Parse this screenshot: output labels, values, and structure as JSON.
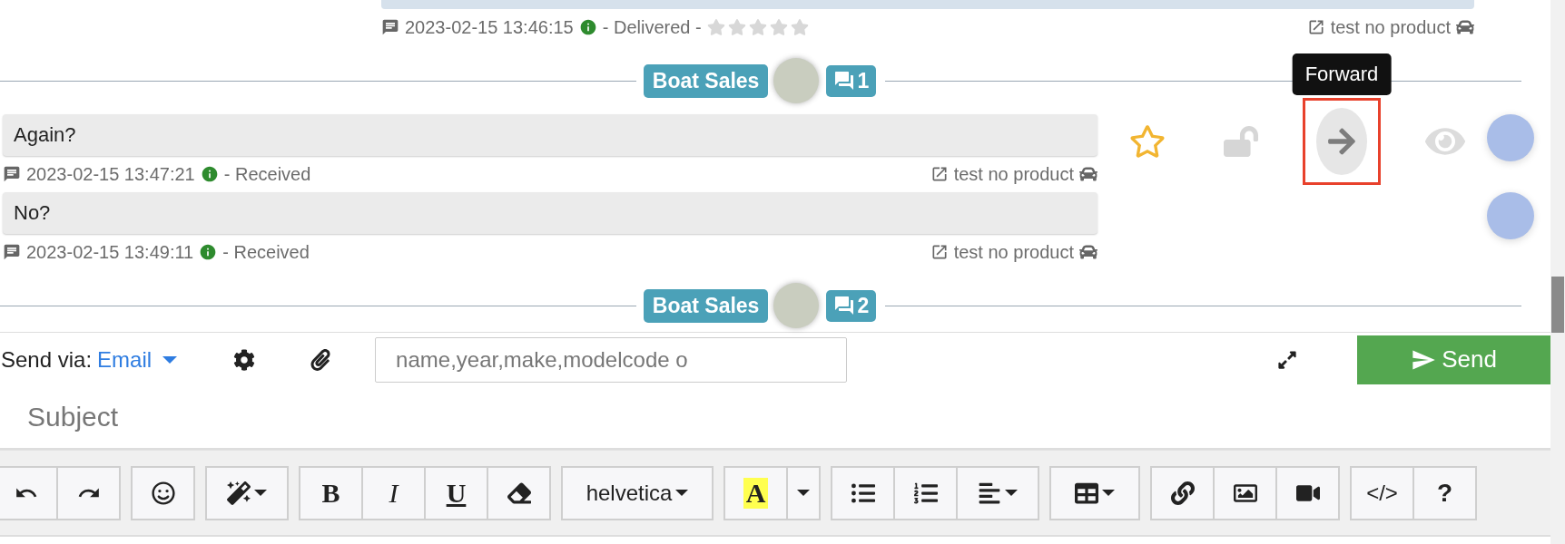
{
  "top_message": {
    "time": "2023-02-15 13:46:15",
    "status": "- Delivered -",
    "stars": 0,
    "link": "test no product"
  },
  "threads": [
    {
      "label": "Boat Sales",
      "count": "1",
      "messages": [
        {
          "text": "Again?",
          "time": "2023-02-15 13:47:21",
          "status": "- Received",
          "link": "test no product",
          "actions": [
            {
              "kind": "star",
              "starred": false
            },
            {
              "kind": "lock"
            },
            {
              "kind": "forward",
              "tooltip": "Forward",
              "highlighted": true
            },
            {
              "kind": "eye"
            }
          ]
        },
        {
          "text": "No?",
          "time": "2023-02-15 13:49:11",
          "status": "- Received",
          "link": "test no product"
        }
      ]
    },
    {
      "label": "Boat Sales",
      "count": "2"
    }
  ],
  "composer": {
    "send_via_label": "Send via:",
    "channel": "Email",
    "input_placeholder": "name,year,make,modelcode o",
    "send_label": "Send",
    "subject_placeholder": "Subject"
  },
  "toolbar": [
    [
      {
        "kind": "undo"
      },
      {
        "kind": "redo"
      }
    ],
    [
      {
        "kind": "emoji"
      }
    ],
    [
      {
        "kind": "magic",
        "dropdown": true
      }
    ],
    [
      {
        "kind": "bold",
        "label": "B"
      },
      {
        "kind": "italic",
        "label": "I"
      },
      {
        "kind": "underline",
        "label": "U"
      },
      {
        "kind": "eraser"
      }
    ],
    [
      {
        "kind": "font",
        "label": "helvetica",
        "dropdown": true
      }
    ],
    [
      {
        "kind": "highlight",
        "label": "A"
      },
      {
        "kind": "caret",
        "dropdown": true
      }
    ],
    [
      {
        "kind": "bullets"
      },
      {
        "kind": "numbers"
      },
      {
        "kind": "align",
        "dropdown": true
      }
    ],
    [
      {
        "kind": "table",
        "dropdown": true
      }
    ],
    [
      {
        "kind": "link"
      },
      {
        "kind": "image"
      },
      {
        "kind": "video"
      }
    ],
    [
      {
        "kind": "code",
        "label": "</>"
      },
      {
        "kind": "help",
        "label": "?"
      }
    ]
  ]
}
